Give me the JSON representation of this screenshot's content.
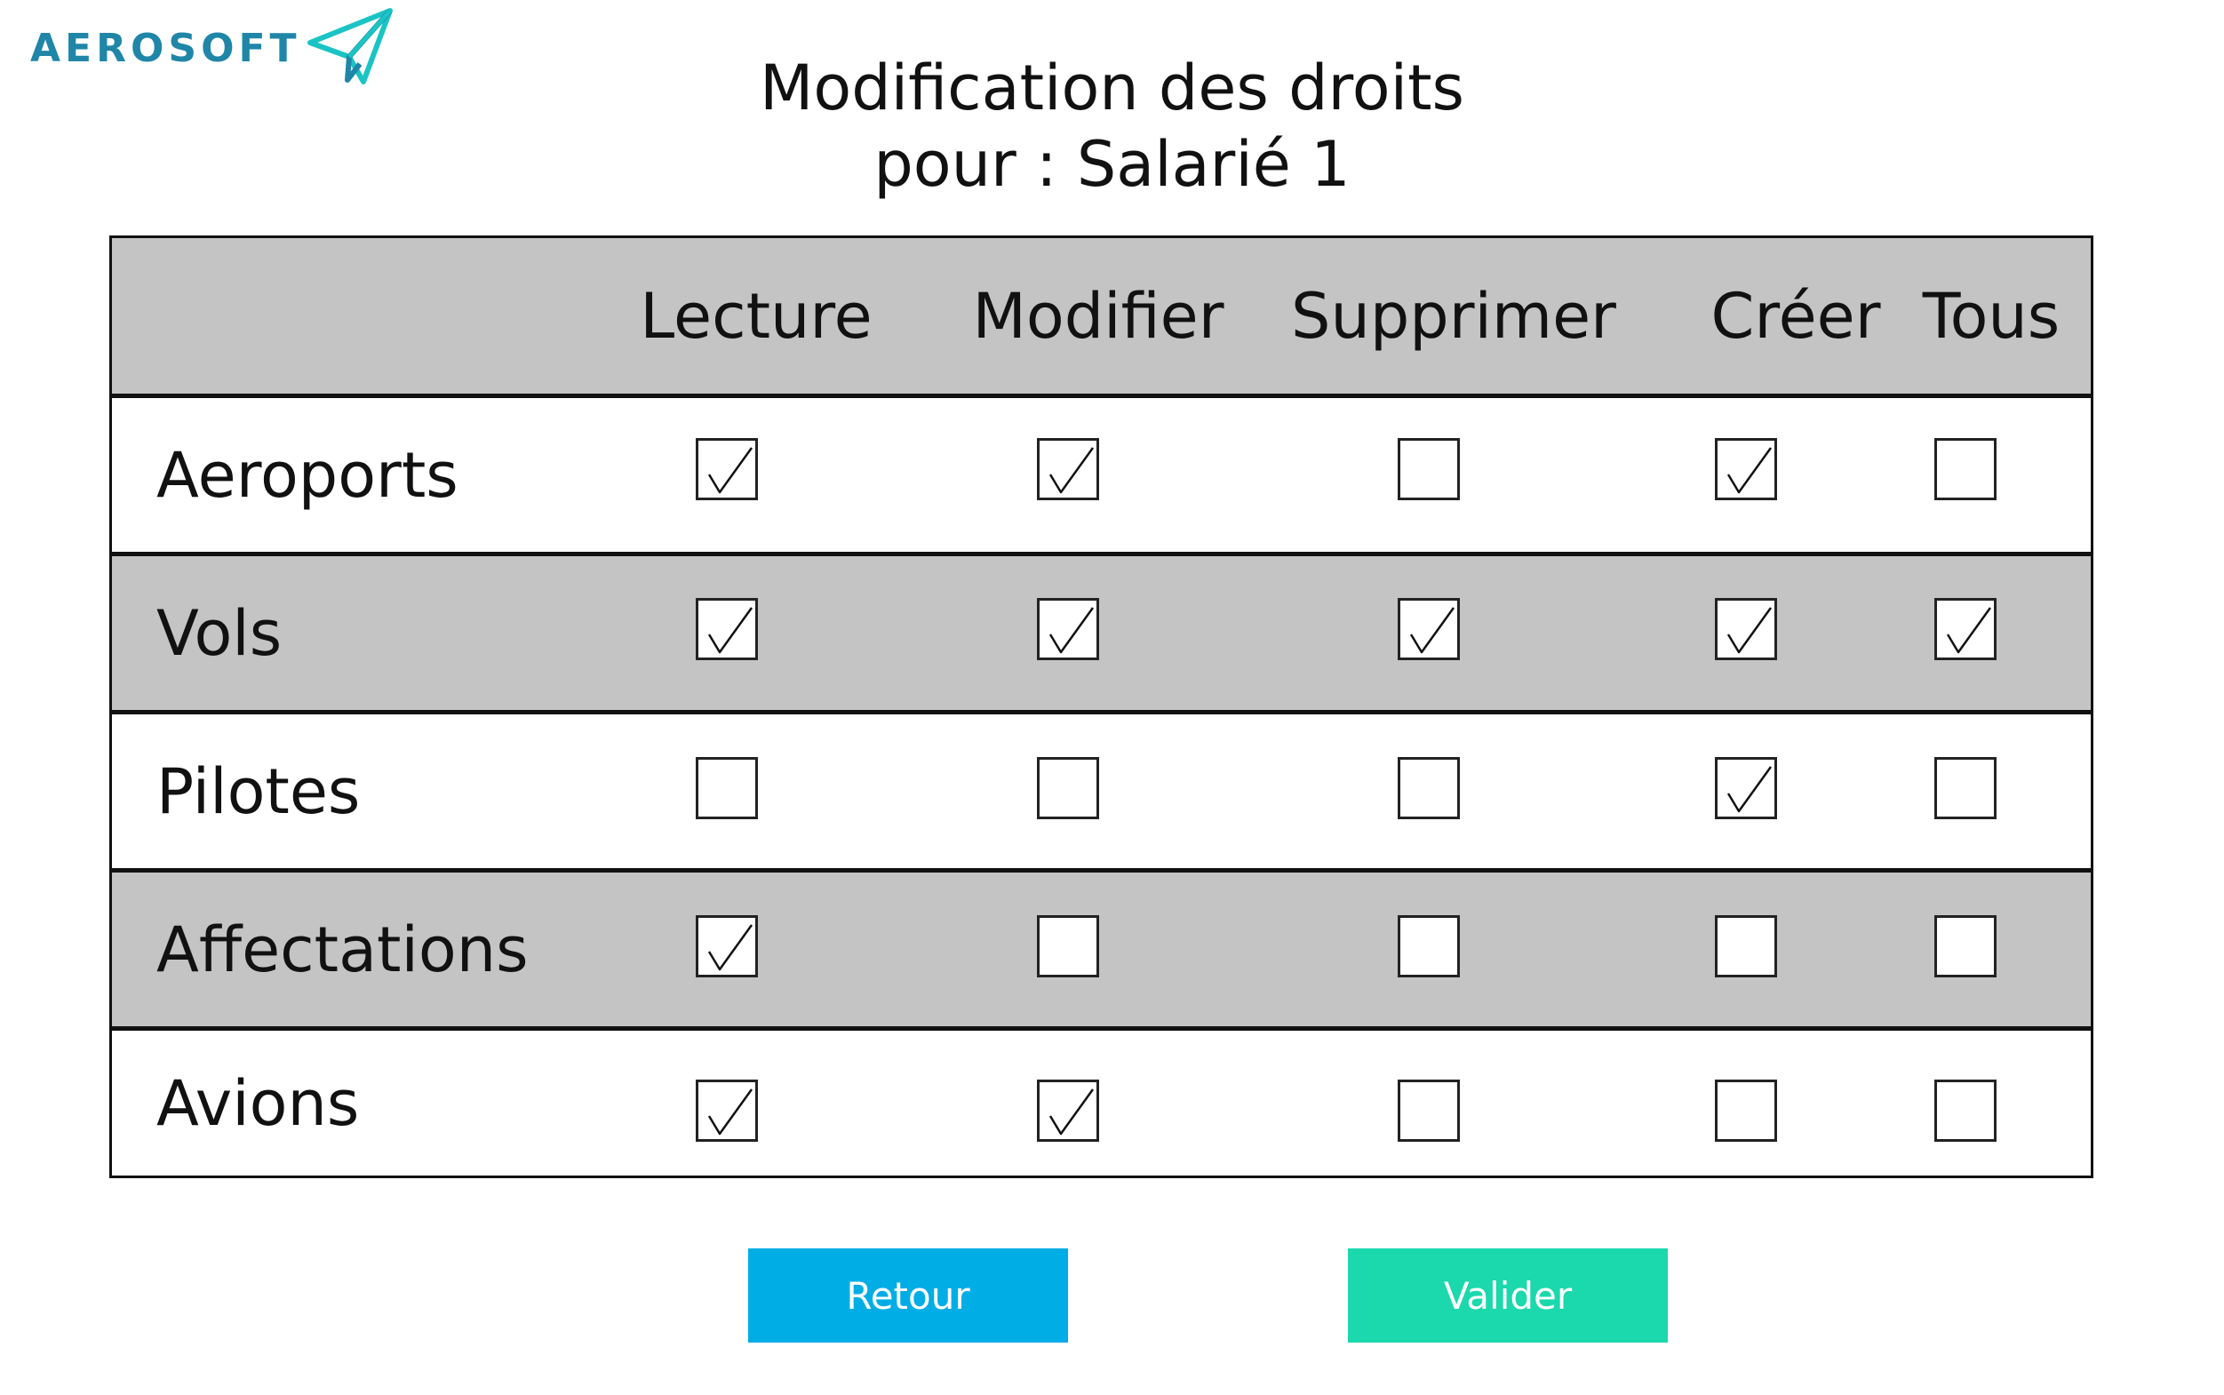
{
  "brand": {
    "name": "AEROSOFT",
    "color": "#1f86a8",
    "icon": "paper-plane-icon"
  },
  "page": {
    "title_line1": "Modification des droits",
    "title_line2": "pour : Salarié 1"
  },
  "table": {
    "columns": [
      "Lecture",
      "Modifier",
      "Supprimer",
      "Créer",
      "Tous"
    ],
    "rows": [
      {
        "label": "Aeroports",
        "checked": [
          true,
          true,
          false,
          true,
          false
        ]
      },
      {
        "label": "Vols",
        "checked": [
          true,
          true,
          true,
          true,
          true
        ]
      },
      {
        "label": "Pilotes",
        "checked": [
          false,
          false,
          false,
          true,
          false
        ]
      },
      {
        "label": "Affectations",
        "checked": [
          true,
          false,
          false,
          false,
          false
        ]
      },
      {
        "label": "Avions",
        "checked": [
          true,
          true,
          false,
          false,
          false
        ]
      }
    ],
    "header_bg": "#c4c4c4",
    "shaded_row_bg": "#c4c4c4"
  },
  "buttons": {
    "back_label": "Retour",
    "back_color": "#00ade5",
    "submit_label": "Valider",
    "submit_color": "#1bd8ad"
  }
}
